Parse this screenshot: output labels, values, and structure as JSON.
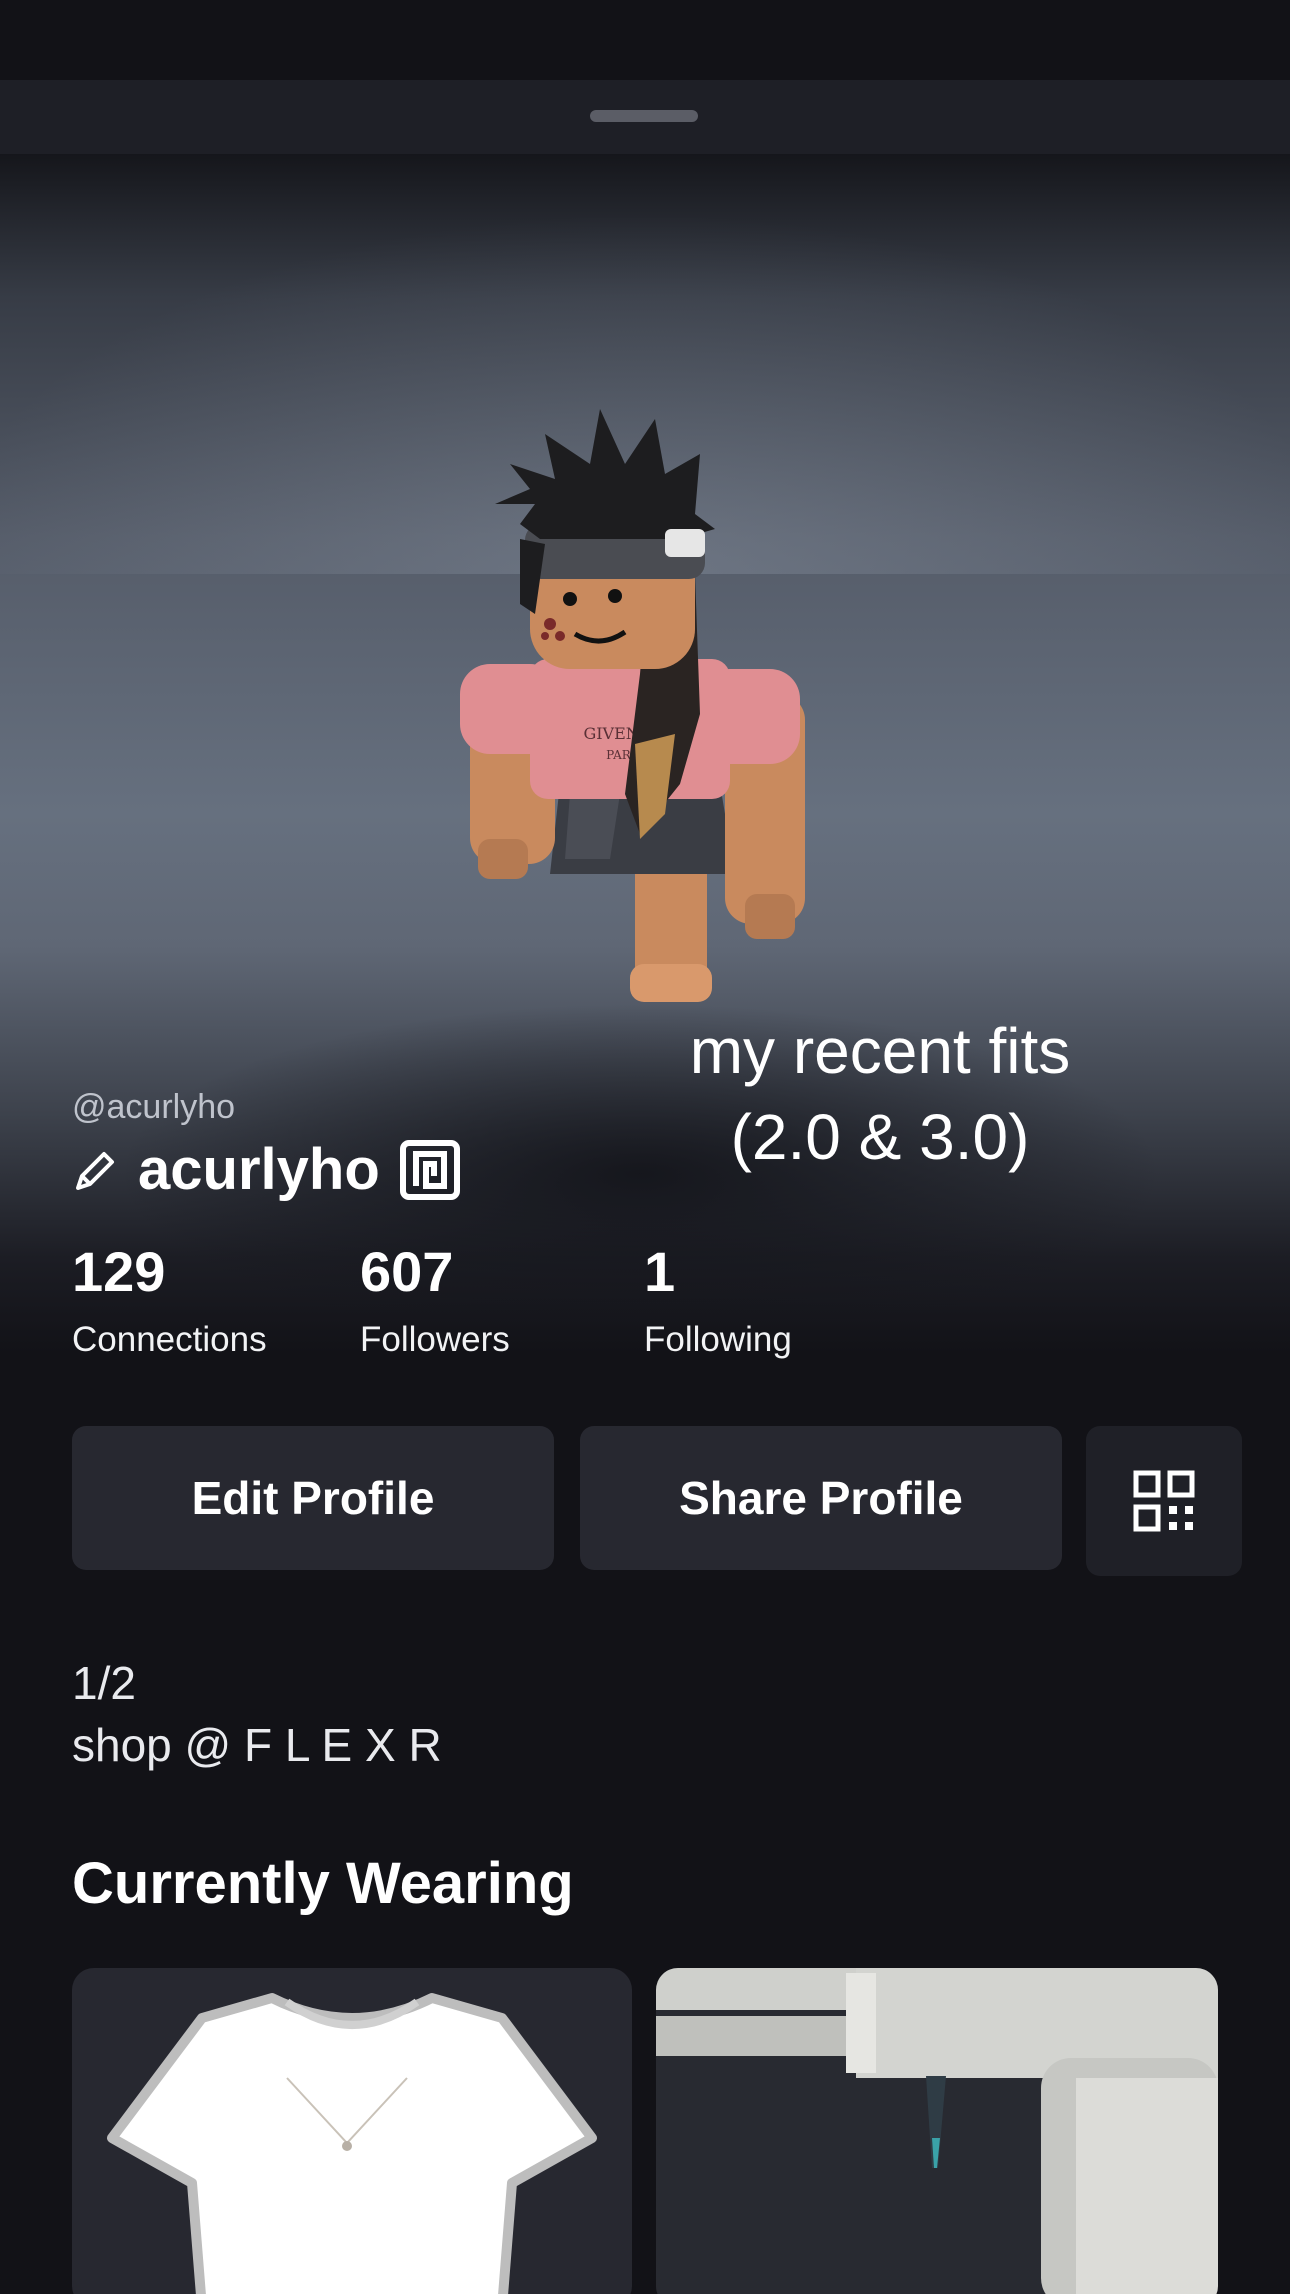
{
  "profile": {
    "display_name": "acurlyho",
    "username": "@acurlyho"
  },
  "overlay": {
    "line1": "my recent fits",
    "line2": "(2.0 & 3.0)"
  },
  "stats": [
    {
      "value": "129",
      "label": "Connections"
    },
    {
      "value": "607",
      "label": "Followers"
    },
    {
      "value": "1",
      "label": "Following"
    }
  ],
  "actions": {
    "edit": "Edit Profile",
    "share": "Share Profile"
  },
  "bio": {
    "line1": "1/2",
    "line2": "shop @ F L E X R"
  },
  "wearing": {
    "title": "Currently Wearing"
  },
  "avatar_shirt_text": {
    "line1": "GIVENCHY",
    "line2": "PARIS"
  },
  "icons": [
    "pencil-icon",
    "premium-icon",
    "qr-code-icon"
  ],
  "colors": {
    "background": "#121217",
    "button": "#272830",
    "text": "#ffffff",
    "muted_text": "#bfc3cc"
  }
}
